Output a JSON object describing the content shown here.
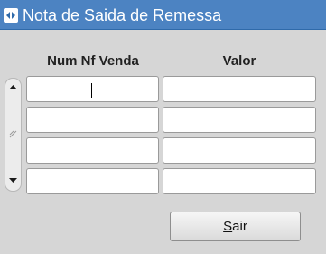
{
  "window": {
    "title": "Nota de Saida de Remessa",
    "icon": "oracle-forms-window-icon"
  },
  "table": {
    "columns": [
      "Num Nf Venda",
      "Valor"
    ],
    "rows": [
      {
        "num_nf_venda": "",
        "valor": ""
      },
      {
        "num_nf_venda": "",
        "valor": ""
      },
      {
        "num_nf_venda": "",
        "valor": ""
      },
      {
        "num_nf_venda": "",
        "valor": ""
      }
    ],
    "focused_row": 1,
    "focused_column": "Num Nf Venda"
  },
  "buttons": {
    "sair": {
      "label": "Sair",
      "mnemonic": "S",
      "label_rest": "air"
    }
  },
  "colors": {
    "titlebar": "#4c83c2",
    "background": "#d6d6d6",
    "cell": "#ffffff"
  }
}
